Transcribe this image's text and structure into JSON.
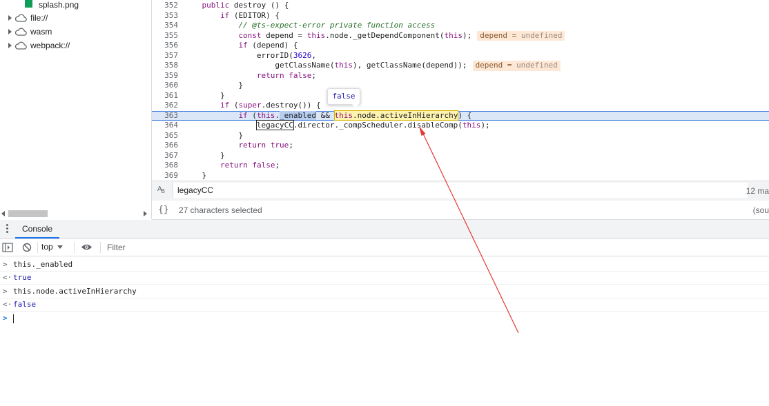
{
  "sidebar": {
    "file_item": "splash.png",
    "tree": [
      {
        "label": "file://"
      },
      {
        "label": "wasm"
      },
      {
        "label": "webpack://"
      }
    ]
  },
  "editor": {
    "lines": [
      {
        "n": "352",
        "html": "<span class=\"kw\">public</span> destroy () {",
        "indent": 4
      },
      {
        "n": "353",
        "html": "<span class=\"kw\">if</span> (EDITOR) {",
        "indent": 8
      },
      {
        "n": "354",
        "html": "<span class=\"cm\">// @ts-expect-error private function access</span>",
        "indent": 12
      },
      {
        "n": "355",
        "html": "<span class=\"kw\">const</span> depend = <span class=\"kw\">this</span>.node._getDependComponent(<span class=\"kw\">this</span>);<span class=\"inline-val\">depend = <span class=\"undef\">undefined</span></span>",
        "indent": 12
      },
      {
        "n": "356",
        "html": "<span class=\"kw\">if</span> (depend) {",
        "indent": 12
      },
      {
        "n": "357",
        "html": "errorID(<span class=\"num\">3626</span>,",
        "indent": 16
      },
      {
        "n": "358",
        "html": "getClassName(<span class=\"kw\">this</span>), getClassName(depend));<span class=\"inline-val\">depend = <span class=\"undef\">undefined</span></span>",
        "indent": 20
      },
      {
        "n": "359",
        "html": "<span class=\"kw\">return</span> <span class=\"kw\">false</span>;",
        "indent": 16
      },
      {
        "n": "360",
        "html": "}",
        "indent": 12
      },
      {
        "n": "361",
        "html": "}",
        "indent": 8
      },
      {
        "n": "362",
        "html": "<span class=\"kw\">if</span> (<span class=\"kw\">super</span>.destroy()) {",
        "indent": 8
      },
      {
        "n": "363",
        "html": "<span class=\"kw\">if</span> (<span class=\"kw\">this</span>.<span class=\"sel-a\">_enabled</span> &amp;&amp; <span class=\"sel-b\"><span class=\"kw\">this</span>.node.activeInHierarchy</span>) {",
        "indent": 12,
        "current": true
      },
      {
        "n": "364",
        "html": "<span class=\"boxed\">legacyCC</span>.director._compScheduler.disableComp(<span class=\"kw\">this</span>);",
        "indent": 16
      },
      {
        "n": "365",
        "html": "}",
        "indent": 12
      },
      {
        "n": "366",
        "html": "<span class=\"kw\">return</span> <span class=\"kw\">true</span>;",
        "indent": 12
      },
      {
        "n": "367",
        "html": "}",
        "indent": 8
      },
      {
        "n": "368",
        "html": "<span class=\"kw\">return</span> <span class=\"kw\">false</span>;",
        "indent": 8
      },
      {
        "n": "369",
        "html": "}",
        "indent": 4
      }
    ],
    "tooltip_value": "false"
  },
  "search": {
    "case_icon": "Aa",
    "query": "legacyCC",
    "match_count": "12 ma"
  },
  "status": {
    "braces": "{}",
    "selection": "27 characters selected",
    "source_hint": "(sou"
  },
  "drawer": {
    "tab_label": "Console"
  },
  "console_toolbar": {
    "context": "top",
    "filter_placeholder": "Filter"
  },
  "console": {
    "messages": [
      {
        "type": "input",
        "text": "this._enabled"
      },
      {
        "type": "result",
        "text": "true"
      },
      {
        "type": "input",
        "text": "this.node.activeInHierarchy"
      },
      {
        "type": "result",
        "text": "false"
      }
    ]
  },
  "colors": {
    "accent": "#1a73e8",
    "annotation_arrow": "#e53935",
    "current_line": "#dbe6f7"
  }
}
